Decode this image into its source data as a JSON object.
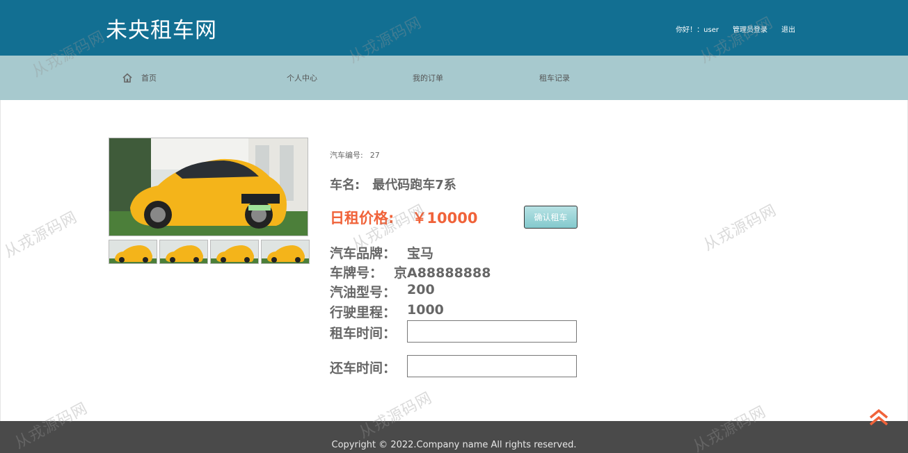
{
  "header": {
    "site_title": "未央租车网",
    "greeting": "你好！：user",
    "admin_login": "管理员登录",
    "logout": "退出"
  },
  "nav": {
    "home": "首页",
    "profile": "个人中心",
    "orders": "我的订单",
    "records": "租车记录"
  },
  "car": {
    "id_label": "汽车编号:",
    "id_value": "27",
    "name_label": "车名:",
    "name_value": "最代码跑车7系",
    "price_label": "日租价格:",
    "price_value": "￥10000",
    "brand_label": "汽车品牌：",
    "brand_value": "宝马",
    "plate_label": "车牌号：",
    "plate_value": "京A88888888",
    "fuel_label": "汽油型号：",
    "fuel_value": "200",
    "mileage_label": "行驶里程：",
    "mileage_value": "1000"
  },
  "form": {
    "start_label": "租车时间：",
    "start_value": "",
    "end_label": "还车时间：",
    "end_value": "",
    "submit_label": "确认租车"
  },
  "footer": {
    "copyright": "Copyright © 2022.Company name All rights reserved."
  },
  "watermark": "从戎源码网",
  "colors": {
    "header_bg": "#126f92",
    "nav_bg": "#a7c9ce",
    "price": "#f0633a",
    "footer_bg": "#4a4a4a",
    "back_top": "#f0633a"
  }
}
